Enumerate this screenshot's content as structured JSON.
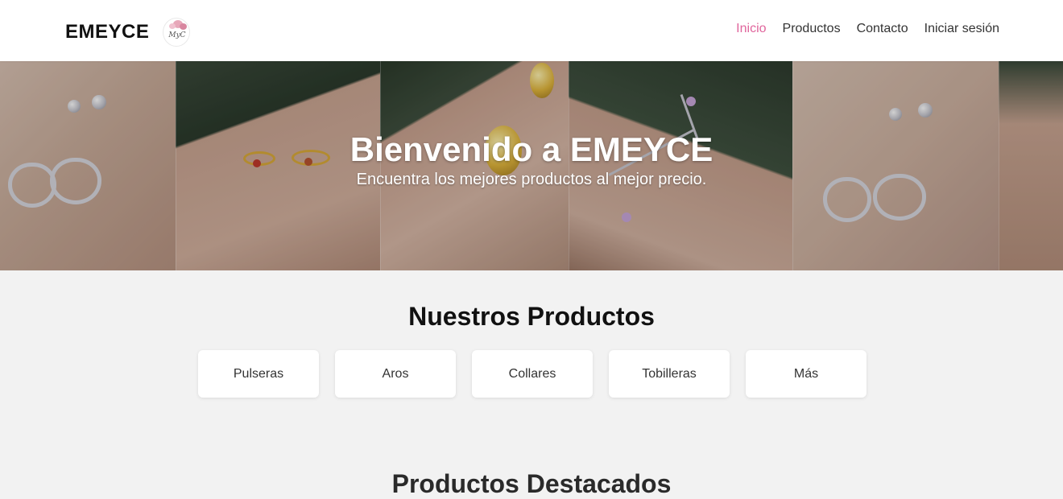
{
  "brand": {
    "name": "EMEYCE",
    "logo_text": "MyC"
  },
  "nav": {
    "items": [
      {
        "label": "Inicio",
        "active": true
      },
      {
        "label": "Productos",
        "active": false
      },
      {
        "label": "Contacto",
        "active": false
      },
      {
        "label": "Iniciar sesión",
        "active": false
      }
    ],
    "active_color": "#e0659c"
  },
  "hero": {
    "title": "Bienvenido a EMEYCE",
    "subtitle": "Encuentra los mejores productos al mejor precio."
  },
  "products": {
    "title": "Nuestros Productos",
    "categories": [
      "Pulseras",
      "Aros",
      "Collares",
      "Tobilleras",
      "Más"
    ]
  },
  "featured": {
    "title": "Productos Destacados"
  }
}
